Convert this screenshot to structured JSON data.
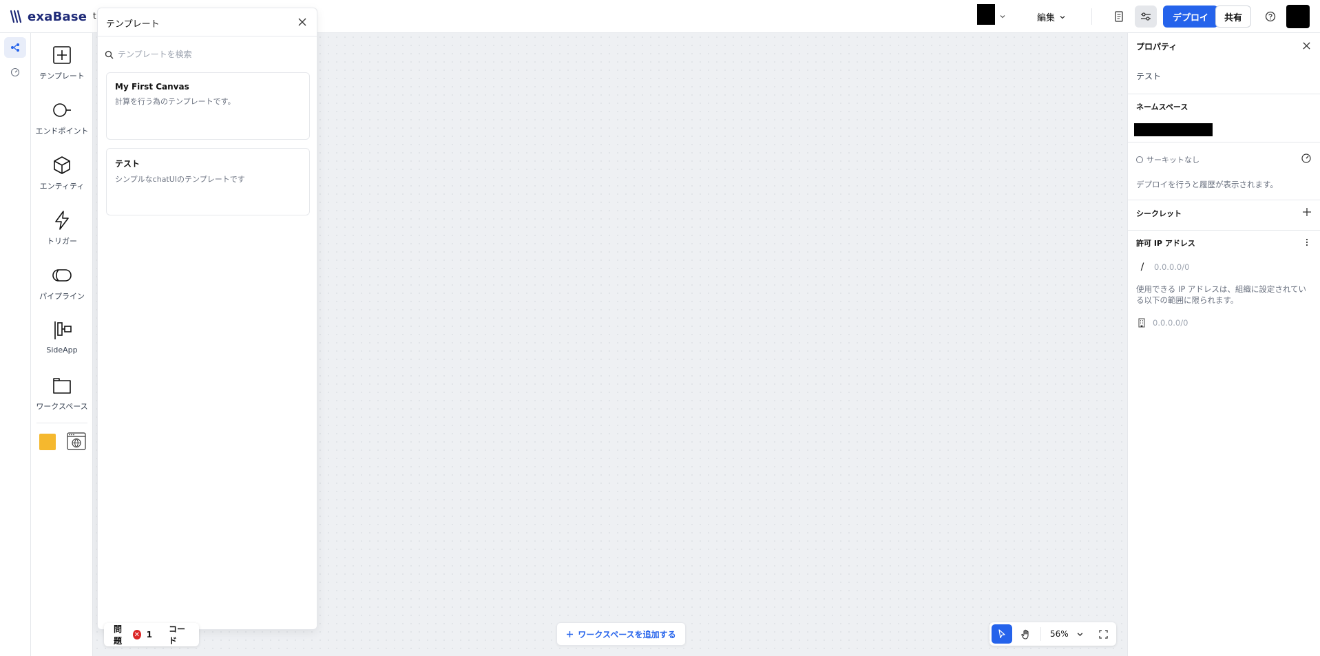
{
  "app": {
    "logo_text": "exaBase",
    "crumb_letter": "t"
  },
  "topbar": {
    "edit_label": "編集",
    "deploy_label": "デプロイ",
    "share_label": "共有"
  },
  "palette": {
    "tools": [
      {
        "id": "template",
        "label": "テンプレート",
        "icon": "plus-square-icon"
      },
      {
        "id": "endpoint",
        "label": "エンドポイント",
        "icon": "endpoint-icon"
      },
      {
        "id": "entity",
        "label": "エンティティ",
        "icon": "cube-icon"
      },
      {
        "id": "trigger",
        "label": "トリガー",
        "icon": "lightning-icon"
      },
      {
        "id": "pipeline",
        "label": "パイプライン",
        "icon": "pipe-icon"
      },
      {
        "id": "sideapp",
        "label": "SideApp",
        "icon": "sideapp-icon"
      },
      {
        "id": "workspace",
        "label": "ワークスペース",
        "icon": "folder-icon"
      }
    ]
  },
  "template_panel": {
    "title": "テンプレート",
    "search_placeholder": "テンプレートを検索",
    "cards": [
      {
        "title": "My First Canvas",
        "desc": "計算を行う為のテンプレートです。"
      },
      {
        "title": "テスト",
        "desc": "シンプルなchatUIのテンプレートです"
      }
    ]
  },
  "bottom": {
    "issues_label": "問題",
    "issues_count": "1",
    "code_label": "コード",
    "add_workspace_label": "ワークスペースを追加する",
    "zoom_value": "56%"
  },
  "properties": {
    "title": "プロパティ",
    "name": "テスト",
    "namespace_label": "ネームスペース",
    "circuit_label": "サーキットなし",
    "deploy_note": "デプロイを行うと履歴が表示されます。",
    "secret_label": "シークレット",
    "allowed_ip_label": "許可 IP アドレス",
    "ip_input_placeholder": "0.0.0.0/0",
    "ip_note": "使用できる IP アドレスは、組織に設定されている以下の範囲に限られます。",
    "org_ip_range": "0.0.0.0/0"
  },
  "colors": {
    "accent": "#2563eb",
    "brand": "#1e2a78",
    "error": "#dc2626",
    "sticky": "#f5b82e"
  }
}
